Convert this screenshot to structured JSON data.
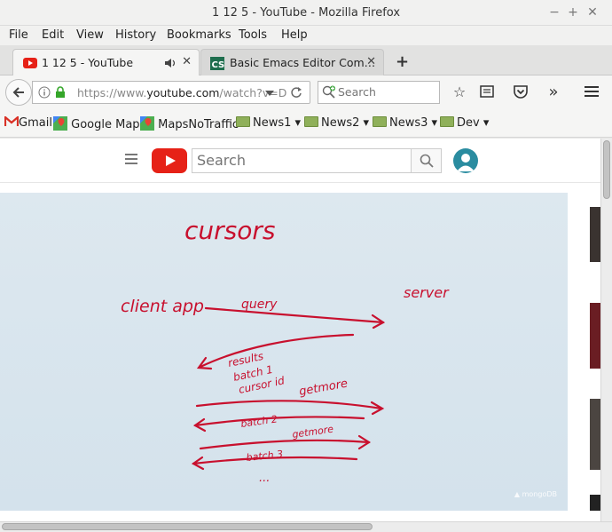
{
  "window": {
    "title": "1 12 5 - YouTube - Mozilla Firefox",
    "controls": [
      "−",
      "+",
      "✕"
    ]
  },
  "menubar": {
    "items": [
      {
        "label": "File",
        "accel": "F"
      },
      {
        "label": "Edit",
        "accel": "E"
      },
      {
        "label": "View",
        "accel": "V"
      },
      {
        "label": "History",
        "accel": "H"
      },
      {
        "label": "Bookmarks",
        "accel": "B"
      },
      {
        "label": "Tools",
        "accel": "T"
      },
      {
        "label": "Help",
        "accel": "H"
      }
    ]
  },
  "tabs": [
    {
      "label": "1 12 5 - YouTube",
      "icon": "youtube-favicon",
      "audio": true,
      "active": true
    },
    {
      "label": "Basic Emacs Editor Com…",
      "icon": "cs-favicon",
      "active": false
    }
  ],
  "new_tab_label": "+",
  "navbar": {
    "url_prefix": "https://www.",
    "url_host": "youtube.com",
    "url_rest": "/watch?v=D",
    "search_placeholder": "Search"
  },
  "bookmarks": [
    {
      "label": "Gmail",
      "icon": "gmail-icon"
    },
    {
      "label": "Google Maps",
      "icon": "maps-icon"
    },
    {
      "label": "MapsNoTraffic",
      "icon": "maps-icon"
    },
    {
      "label": "News1",
      "folder": true
    },
    {
      "label": "News2",
      "folder": true
    },
    {
      "label": "News3",
      "folder": true
    },
    {
      "label": "Dev",
      "folder": true
    }
  ],
  "youtube": {
    "search_placeholder": "Search",
    "watermark": "mongoDB"
  },
  "whiteboard": {
    "title": "cursors",
    "client": "client app",
    "server": "server",
    "query": "query",
    "results1": "results",
    "results2": "batch 1",
    "results3": "cursor id",
    "getmore1": "getmore",
    "batch2": "batch 2",
    "getmore2": "getmore",
    "batch3": "batch 3",
    "ellipsis": "..."
  },
  "colors": {
    "ink": "#c8102e",
    "youtube_red": "#e62117",
    "board": "#d9e5ee"
  }
}
